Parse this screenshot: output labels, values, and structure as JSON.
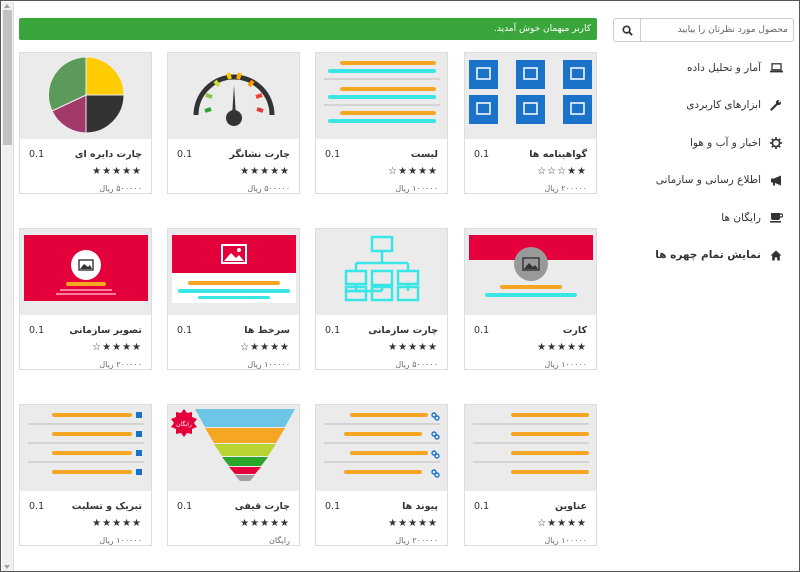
{
  "search": {
    "placeholder": "محصول مورد نظرتان را بیابید"
  },
  "welcome": "کاربر میهمان خوش آمدید.",
  "menu": [
    {
      "label": "آمار و تحلیل داده",
      "icon": "laptop-icon"
    },
    {
      "label": "ابزارهای کاربردی",
      "icon": "wrench-icon"
    },
    {
      "label": "اخبار و آب و هوا",
      "icon": "gear-icon"
    },
    {
      "label": "اطلاع رسانی و سازمانی",
      "icon": "bullhorn-icon"
    },
    {
      "label": "رایگان ها",
      "icon": "coffee-icon"
    },
    {
      "label": "نمایش تمام چهره ها",
      "icon": "home-icon"
    }
  ],
  "cards": [
    {
      "title": "گواهینامه ها",
      "version": "0.1",
      "stars": "★★☆☆☆",
      "price": "۲۰۰۰۰۰ ریال"
    },
    {
      "title": "لیست",
      "version": "0.1",
      "stars": "★★★★☆",
      "price": "۱۰۰۰۰۰ ریال"
    },
    {
      "title": "چارت نشانگر",
      "version": "0.1",
      "stars": "★★★★★",
      "price": "۵۰۰۰۰۰ ریال"
    },
    {
      "title": "چارت دایره ای",
      "version": "0.1",
      "stars": "★★★★★",
      "price": "۵۰۰۰۰۰ ریال"
    },
    {
      "title": "کارت",
      "version": "0.1",
      "stars": "★★★★★",
      "price": "۱۰۰۰۰۰ ریال"
    },
    {
      "title": "چارت سازمانی",
      "version": "0.1",
      "stars": "★★★★★",
      "price": "۵۰۰۰۰۰ ریال"
    },
    {
      "title": "سرخط ها",
      "version": "0.1",
      "stars": "★★★★☆",
      "price": "۱۰۰۰۰۰ ریال"
    },
    {
      "title": "تصویر سازمانی",
      "version": "0.1",
      "stars": "★★★★☆",
      "price": "۲۰۰۰۰۰ ریال"
    },
    {
      "title": "عناوین",
      "version": "0.1",
      "stars": "★★★★☆",
      "price": "۱۰۰۰۰۰ ریال"
    },
    {
      "title": "پیوند ها",
      "version": "0.1",
      "stars": "★★★★★",
      "price": "۲۰۰۰۰۰ ریال"
    },
    {
      "title": "چارت قیفی",
      "version": "0.1",
      "stars": "★★★★★",
      "price": "رایگان",
      "badge": "رایگان"
    },
    {
      "title": "تبریک و تسلیت",
      "version": "0.1",
      "stars": "★★★★★",
      "price": "۱۰۰۰۰۰ ریال"
    }
  ],
  "colors": {
    "green": "#3aa53a",
    "blue": "#1a73c8",
    "red": "#e4003a",
    "orange": "#f5a623",
    "cyan": "#39e5e5"
  }
}
